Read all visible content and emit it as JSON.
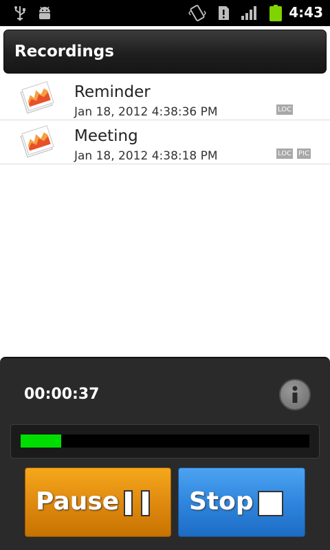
{
  "status_bar": {
    "time": "4:43",
    "icons": [
      "usb-icon",
      "android-debug-icon",
      "vibrate-icon",
      "sd-card-icon",
      "signal-icon",
      "battery-icon"
    ]
  },
  "header": {
    "title": "Recordings"
  },
  "recordings": [
    {
      "name": "Reminder",
      "date": "Jan 18, 2012 4:38:36 PM",
      "tags": [
        "LOC"
      ]
    },
    {
      "name": "Meeting",
      "date": "Jan 18, 2012 4:38:18 PM",
      "tags": [
        "LOC",
        "PIC"
      ]
    }
  ],
  "recorder": {
    "elapsed": "00:00:37",
    "level_fraction": 0.14,
    "pause_label": "Pause",
    "stop_label": "Stop"
  },
  "colors": {
    "accent_pause": "#e99612",
    "accent_stop": "#3a8fe2",
    "meter_level": "#00dd00",
    "battery": "#7fd400"
  }
}
